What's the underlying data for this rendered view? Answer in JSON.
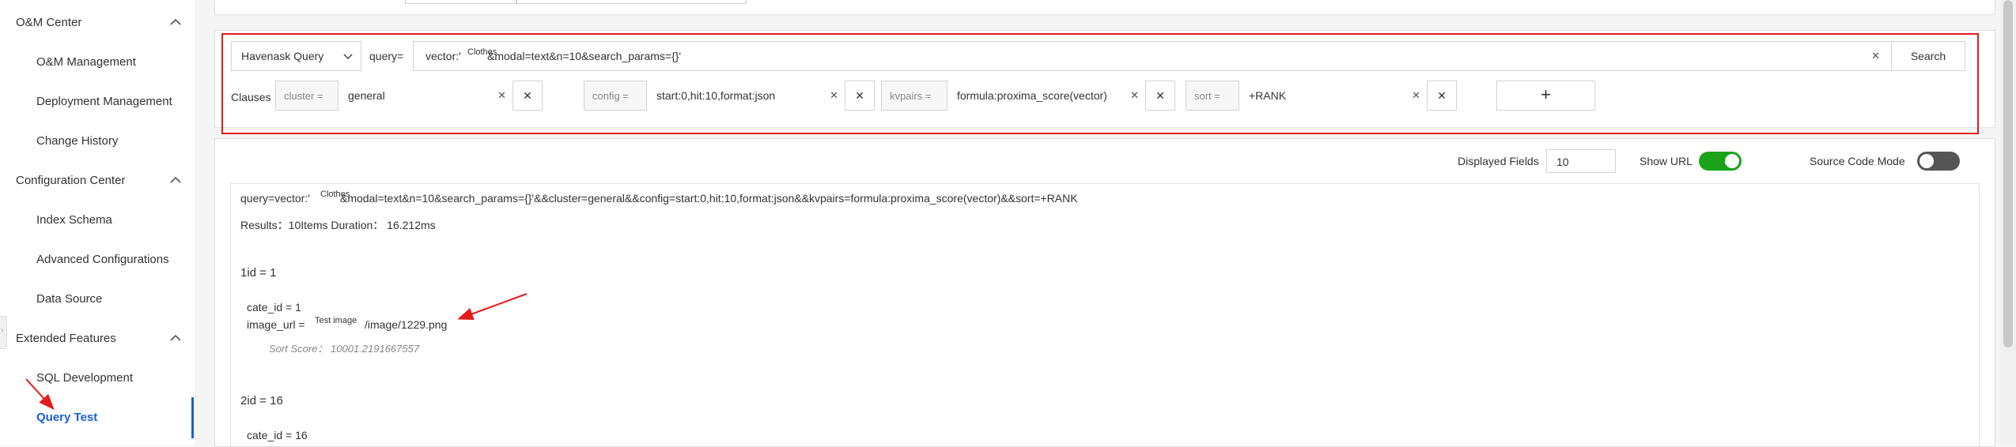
{
  "sidebar": {
    "groups": [
      {
        "label": "O&M Center",
        "items": [
          "O&M Management",
          "Deployment Management",
          "Change History"
        ]
      },
      {
        "label": "Configuration Center",
        "items": [
          "Index Schema",
          "Advanced Configurations",
          "Data Source"
        ]
      },
      {
        "label": "Extended Features",
        "items": [
          "SQL Development",
          "Query Test"
        ]
      }
    ],
    "active_item": "Query Test"
  },
  "query_bar": {
    "engine": "Havenask Query",
    "query_label": "query=",
    "query_value_prefix": "vector:'",
    "query_value_overlay": "Clothes",
    "query_value_suffix": "&modal=text&n=10&search_params={}'",
    "search_button": "Search"
  },
  "clauses": {
    "label": "Clauses",
    "items": [
      {
        "key": "cluster =",
        "value": "general"
      },
      {
        "key": "config =",
        "value": "start:0,hit:10,format:json"
      },
      {
        "key": "kvpairs =",
        "value": "formula:proxima_score(vector)"
      },
      {
        "key": "sort =",
        "value": "+RANK"
      }
    ],
    "add_button": "+"
  },
  "options": {
    "displayed_fields_label": "Displayed Fields",
    "displayed_fields_value": "10",
    "show_url_label": "Show URL",
    "show_url_on": true,
    "source_code_label": "Source Code Mode",
    "source_code_on": false
  },
  "results": {
    "query_prefix": "query=vector:'",
    "query_overlay": "Clothes",
    "query_suffix": "&modal=text&n=10&search_params={}'&&cluster=general&&config=start:0,hit:10,format:json&&kvpairs=formula:proxima_score(vector)&&sort=+RANK",
    "summary": "Results：10Items  Duration： 16.212ms",
    "cards": [
      {
        "title": "1id = 1",
        "fields": [
          "cate_id = 1"
        ],
        "image_url_prefix": "image_url = ",
        "image_url_overlay": "Test image",
        "image_url_suffix": "/image/1229.png",
        "sort_score": "Sort Score： 10001.2191667557"
      },
      {
        "title": "2id = 16",
        "fields": [
          "cate_id = 16"
        ]
      }
    ]
  },
  "colors": {
    "accent": "#1a5fd1",
    "toggle_on": "#1aa31a",
    "toggle_off": "#555555",
    "highlight": "#e61a1a"
  },
  "icons": {
    "chevron_up": "chevron-up-icon",
    "close": "close-icon",
    "clear": "clear-icon",
    "add": "plus-icon"
  }
}
